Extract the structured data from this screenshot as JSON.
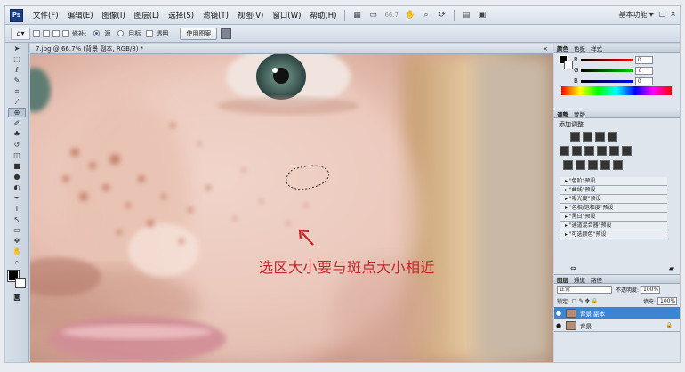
{
  "app": {
    "logo": "Ps"
  },
  "menu": [
    "文件(F)",
    "编辑(E)",
    "图像(I)",
    "图层(L)",
    "选择(S)",
    "滤镜(T)",
    "视图(V)",
    "窗口(W)",
    "帮助(H)"
  ],
  "menubar": {
    "zoom": "66.7",
    "workspace": "基本功能 ▾",
    "window_controls": [
      "–",
      "□",
      "×"
    ]
  },
  "options": {
    "feather_label": "修补:",
    "source_label": "源",
    "target_label": "目标",
    "transparent_label": "透明",
    "use_pattern": "使用图案"
  },
  "document": {
    "tab_title": "7.jpg @ 66.7% (背景 副本, RGB/8) *",
    "close": "×"
  },
  "annotation": {
    "caption": "选区大小要与斑点大小相近",
    "caption_color": "#c8232c"
  },
  "panels": {
    "color": {
      "tabs": [
        "颜色",
        "色板",
        "样式"
      ],
      "rows": [
        {
          "label": "R",
          "value": "0"
        },
        {
          "label": "G",
          "value": "0"
        },
        {
          "label": "B",
          "value": "0"
        }
      ]
    },
    "adjustments": {
      "tabs": [
        "调整",
        "蒙版"
      ],
      "title": "添加调整",
      "presets": [
        "▸ \"色阶\"预设",
        "▸ \"曲线\"预设",
        "▸ \"曝光度\"预设",
        "▸ \"色相/饱和度\"预设",
        "▸ \"黑白\"预设",
        "▸ \"通道混合器\"预设",
        "▸ \"可选颜色\"预设"
      ]
    },
    "layers": {
      "tabs": [
        "图层",
        "通道",
        "路径"
      ],
      "blend_mode": "正常",
      "opacity_label": "不透明度:",
      "opacity": "100%",
      "lock_label": "锁定:",
      "fill_label": "填充:",
      "fill": "100%",
      "items": [
        {
          "name": "背景 副本",
          "selected": true
        },
        {
          "name": "背景",
          "selected": false,
          "lock": "🔒"
        }
      ]
    }
  }
}
